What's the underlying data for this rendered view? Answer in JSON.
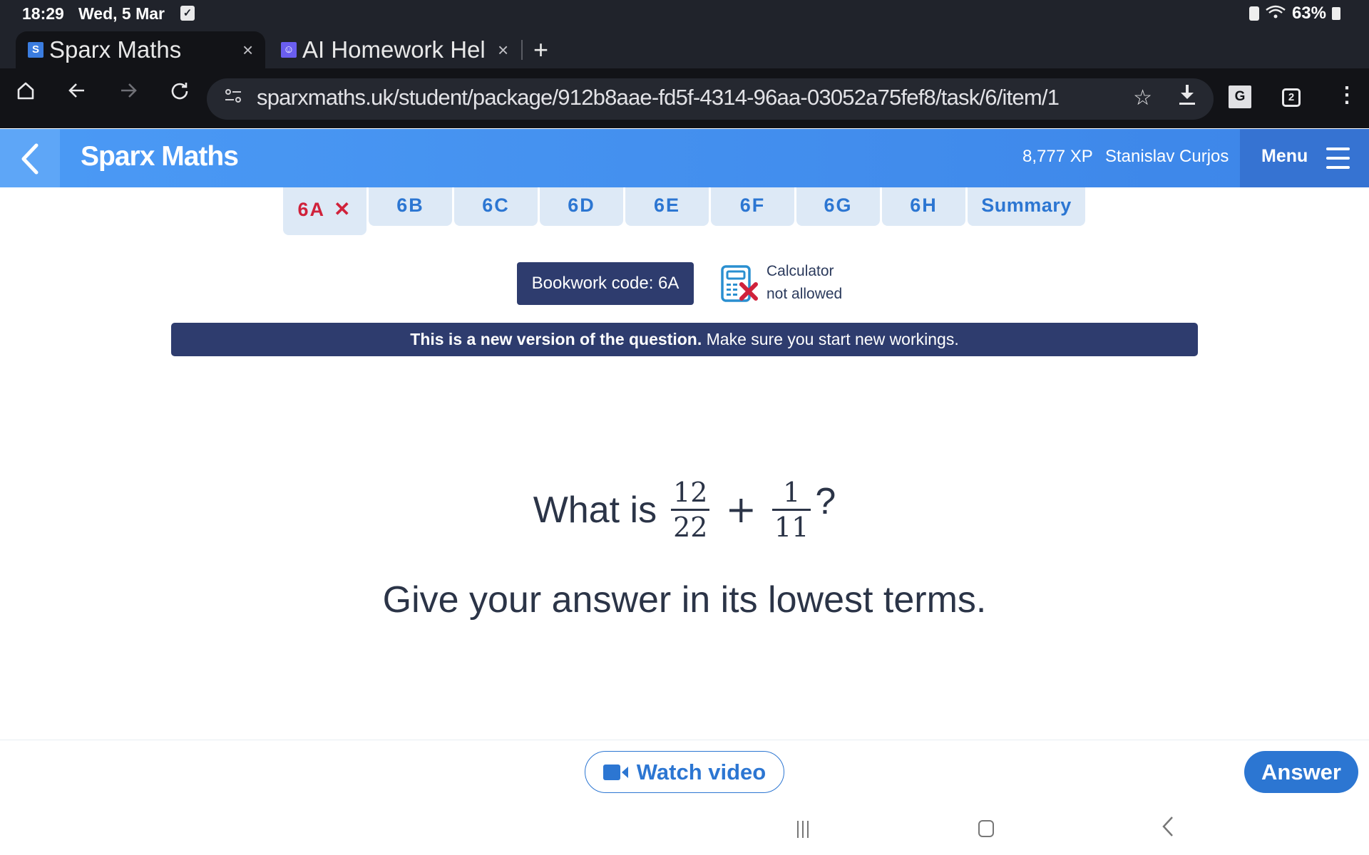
{
  "status_bar": {
    "time": "18:29",
    "date": "Wed, 5 Mar",
    "notification_icon": "checkbox-icon",
    "battery_percent": "63%",
    "icons": [
      "battery-saver-icon",
      "wifi-icon",
      "battery-icon"
    ]
  },
  "browser": {
    "tabs": [
      {
        "title": "Sparx Maths",
        "favicon_letter": "S",
        "favicon_color": "#3b7de0",
        "active": true
      },
      {
        "title": "AI Homework Hel",
        "favicon_letter": "☺",
        "favicon_color": "#6a5ef0",
        "active": false
      }
    ],
    "new_tab_label": "+",
    "close_glyph": "×",
    "url": "sparxmaths.uk/student/package/912b8aae-fd5f-4314-96aa-03052a75fef8/task/6/item/1",
    "tab_count": "2",
    "translate_label": "G",
    "toolbar_icons": [
      "home-icon",
      "back-arrow-icon",
      "forward-arrow-icon",
      "reload-icon",
      "site-settings-icon",
      "bookmark-star-icon",
      "download-icon",
      "translate-icon",
      "tab-switcher-icon",
      "more-menu-icon"
    ]
  },
  "header": {
    "title": "Sparx Maths",
    "xp": "8,777 XP",
    "user_name": "Stanislav Curjos",
    "menu_label": "Menu",
    "brand_color": "#4b9af5"
  },
  "task_tabs": [
    {
      "label": "6A",
      "status": "incorrect",
      "status_glyph": "✕",
      "active": true
    },
    {
      "label": "6B"
    },
    {
      "label": "6C"
    },
    {
      "label": "6D"
    },
    {
      "label": "6E"
    },
    {
      "label": "6F"
    },
    {
      "label": "6G"
    },
    {
      "label": "6H"
    },
    {
      "label": "Summary"
    }
  ],
  "info": {
    "bookwork_code": "Bookwork code: 6A",
    "calculator_line1": "Calculator",
    "calculator_line2": "not allowed"
  },
  "banner": {
    "bold_text": "This is a new version of the question.",
    "text": " Make sure you start new workings."
  },
  "question": {
    "prefix": "What is",
    "fraction1": {
      "numerator": "12",
      "denominator": "22"
    },
    "operator": "+",
    "fraction2": {
      "numerator": "1",
      "denominator": "11"
    },
    "suffix": "?",
    "instruction": "Give your answer in its lowest terms."
  },
  "actions": {
    "watch_video_label": "Watch video",
    "answer_label": "Answer",
    "accent_color": "#2c76d2"
  }
}
